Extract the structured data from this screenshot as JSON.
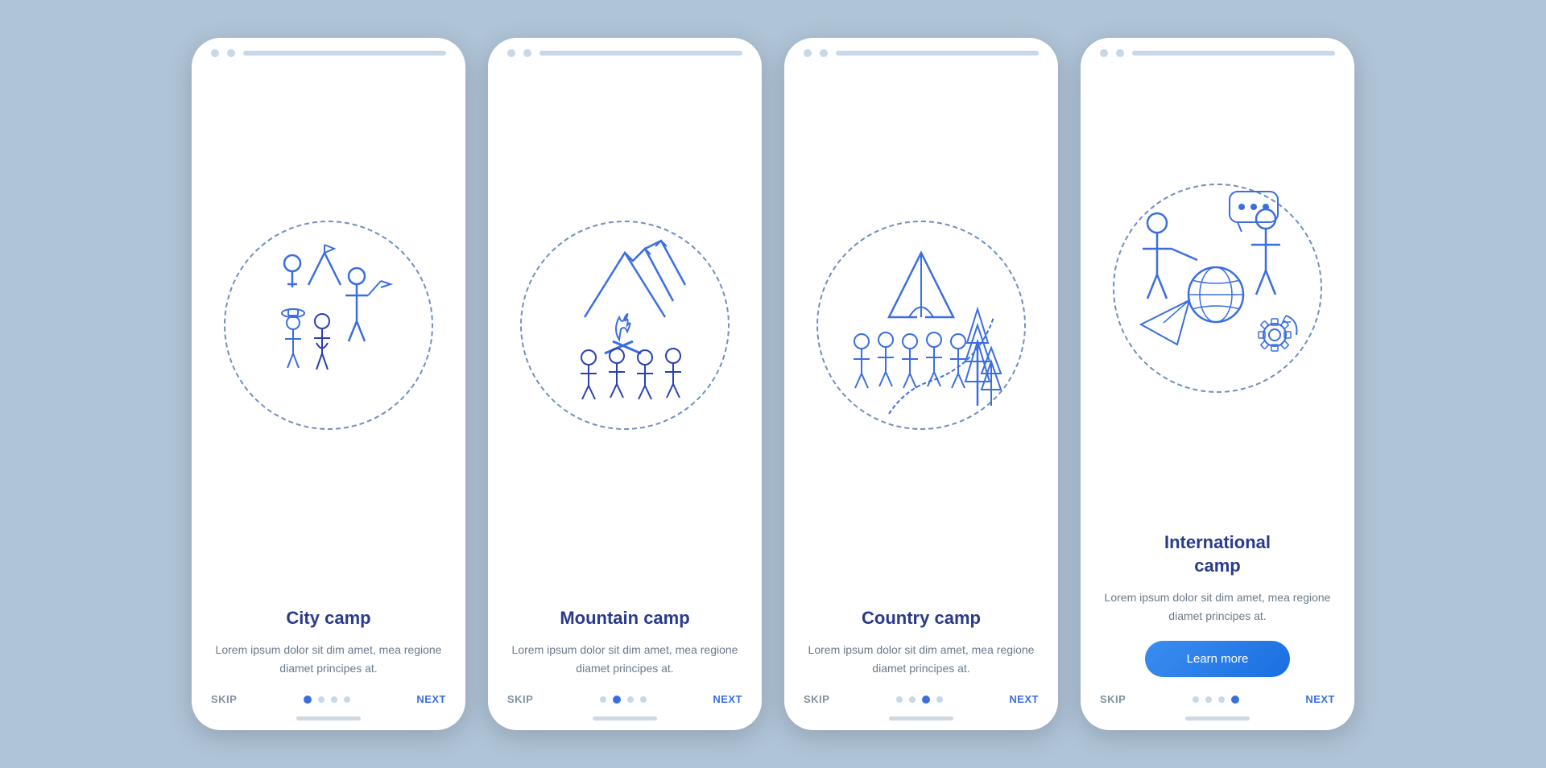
{
  "screens": [
    {
      "id": "city-camp",
      "title": "City camp",
      "description": "Lorem ipsum dolor sit dim amet, mea regione diamet principes at.",
      "has_button": false,
      "active_dot": 0,
      "dots": [
        0,
        1,
        2,
        3
      ],
      "skip_label": "SKIP",
      "next_label": "NEXT"
    },
    {
      "id": "mountain-camp",
      "title": "Mountain camp",
      "description": "Lorem ipsum dolor sit dim amet, mea regione diamet principes at.",
      "has_button": false,
      "active_dot": 1,
      "dots": [
        0,
        1,
        2,
        3
      ],
      "skip_label": "SKIP",
      "next_label": "NEXT"
    },
    {
      "id": "country-camp",
      "title": "Country camp",
      "description": "Lorem ipsum dolor sit dim amet, mea regione diamet principes at.",
      "has_button": false,
      "active_dot": 2,
      "dots": [
        0,
        1,
        2,
        3
      ],
      "skip_label": "SKIP",
      "next_label": "NEXT"
    },
    {
      "id": "international-camp",
      "title": "International\ncamp",
      "description": "Lorem ipsum dolor sit dim amet, mea regione diamet principes at.",
      "has_button": true,
      "button_label": "Learn more",
      "active_dot": 3,
      "dots": [
        0,
        1,
        2,
        3
      ],
      "skip_label": "SKIP",
      "next_label": "NEXT"
    }
  ],
  "colors": {
    "accent": "#3a6ee0",
    "title": "#2a3a8c",
    "desc": "#6a7a8a",
    "dot_inactive": "#c8d8e8",
    "dot_active": "#3a6ee0",
    "icon_blue": "#3a6ee0",
    "icon_dark": "#2a40b0"
  }
}
